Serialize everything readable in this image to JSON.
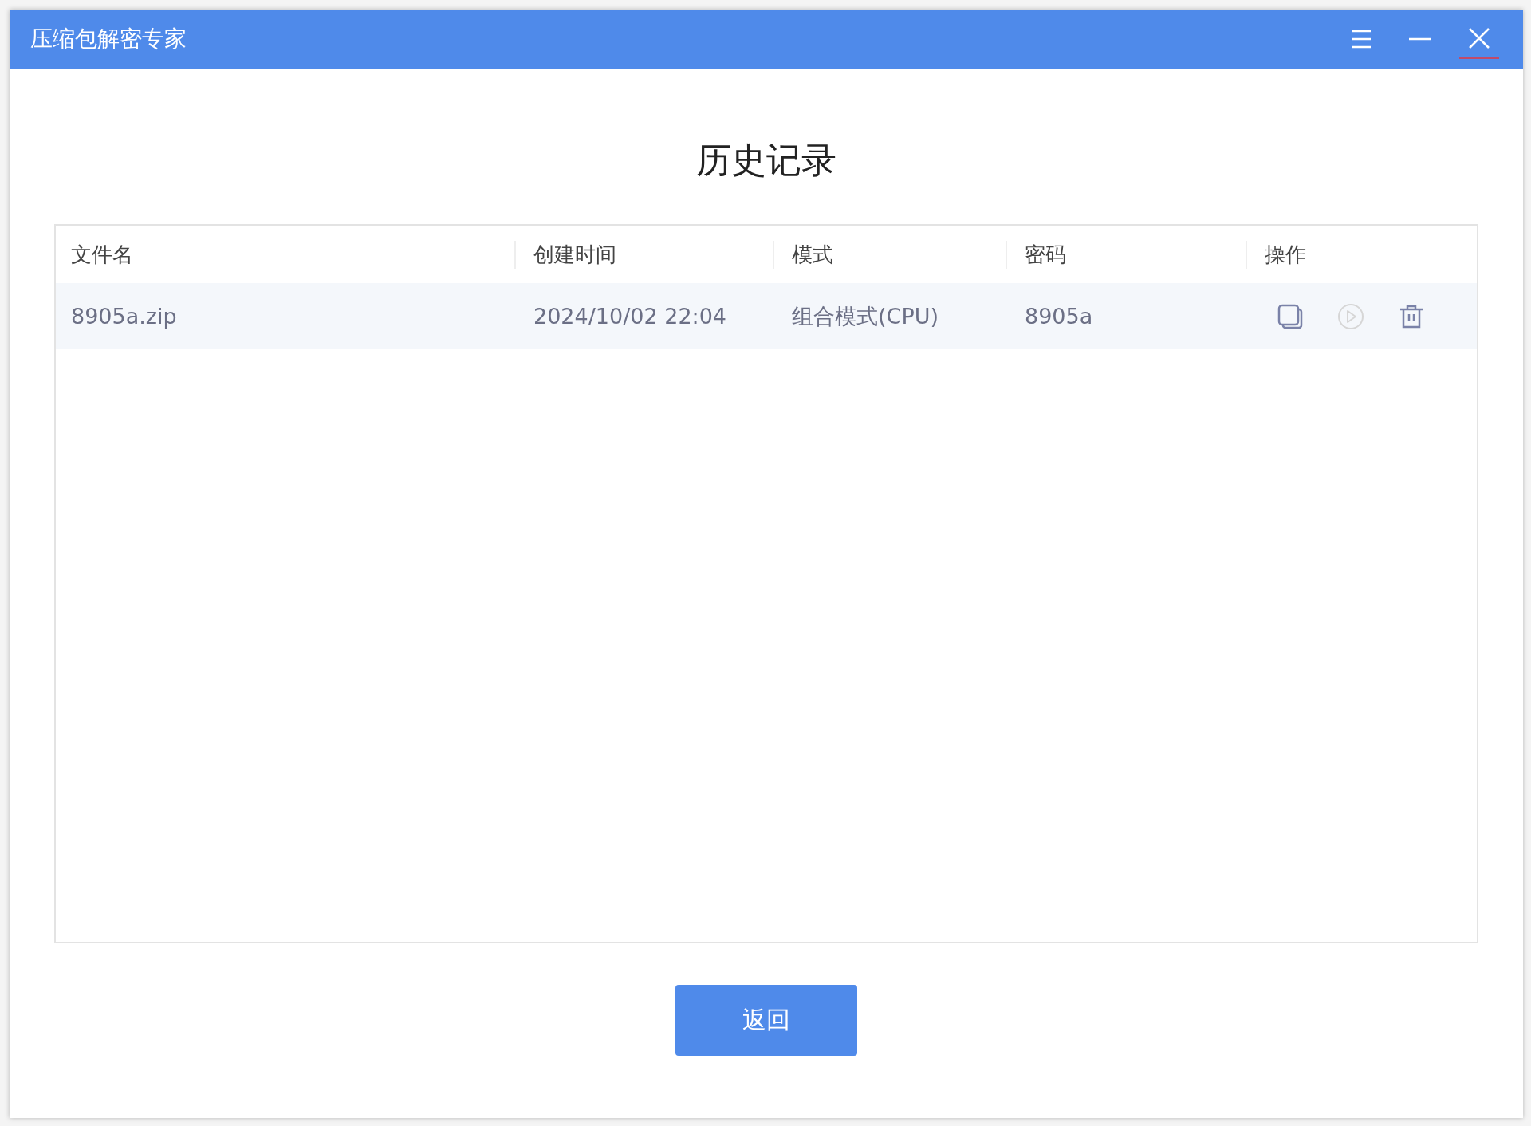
{
  "window": {
    "title": "压缩包解密专家"
  },
  "heading": "历史记录",
  "table": {
    "columns": [
      "文件名",
      "创建时间",
      "模式",
      "密码",
      "操作"
    ],
    "rows": [
      {
        "cells": [
          "8905a.zip",
          "2024/10/02 22:04",
          "组合模式(CPU)",
          "8905a"
        ],
        "actions": [
          {
            "kind": "copy",
            "disabled": false
          },
          {
            "kind": "play",
            "disabled": true
          },
          {
            "kind": "delete",
            "disabled": false
          }
        ]
      }
    ]
  },
  "buttons": [
    "返回"
  ]
}
